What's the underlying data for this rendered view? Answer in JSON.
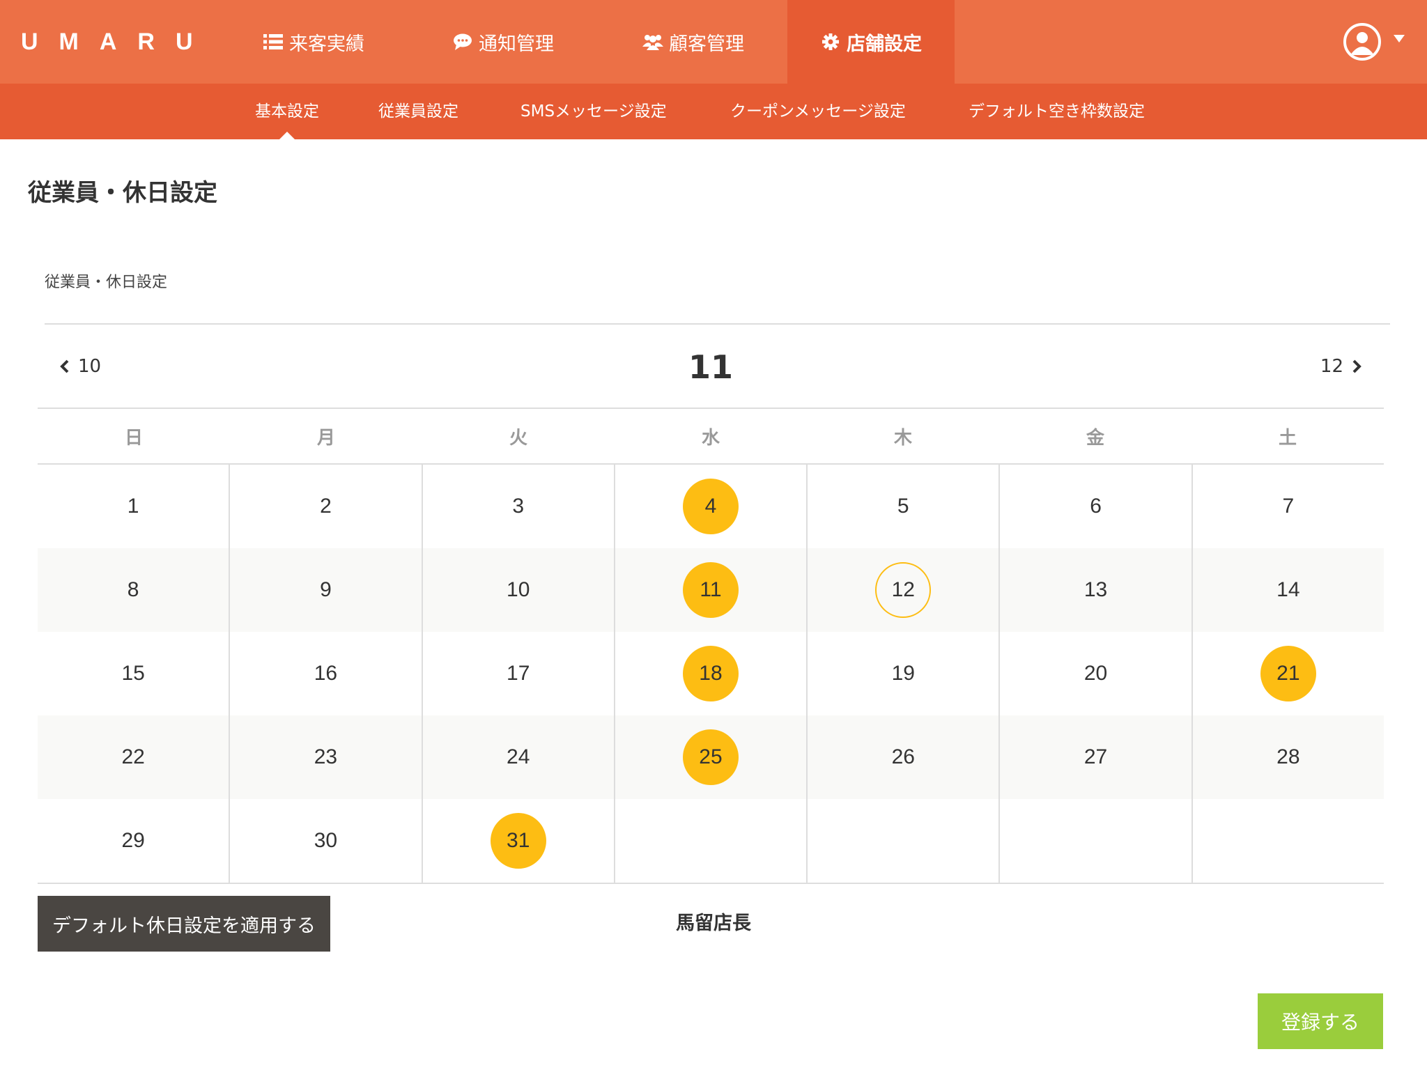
{
  "brand": {
    "logo": "UMARU"
  },
  "nav": {
    "items": [
      {
        "label": "来客実績",
        "icon": "list-icon"
      },
      {
        "label": "通知管理",
        "icon": "chat-bubble-icon"
      },
      {
        "label": "顧客管理",
        "icon": "users-icon"
      },
      {
        "label": "店舗設定",
        "icon": "gear-icon",
        "active": true
      }
    ],
    "user_icon": "user-circle-icon"
  },
  "subnav": {
    "items": [
      {
        "label": "基本設定",
        "active": true
      },
      {
        "label": "従業員設定"
      },
      {
        "label": "SMSメッセージ設定"
      },
      {
        "label": "クーポンメッセージ設定"
      },
      {
        "label": "デフォルト空き枠数設定"
      }
    ]
  },
  "page": {
    "title": "従業員・休日設定",
    "section_label": "従業員・休日設定"
  },
  "calendar": {
    "prev_month": "10",
    "current_month": "11",
    "next_month": "12",
    "weekdays": [
      "日",
      "月",
      "火",
      "水",
      "木",
      "金",
      "土"
    ],
    "weeks": [
      [
        "1",
        "2",
        "3",
        "4",
        "5",
        "6",
        "7"
      ],
      [
        "8",
        "9",
        "10",
        "11",
        "12",
        "13",
        "14"
      ],
      [
        "15",
        "16",
        "17",
        "18",
        "19",
        "20",
        "21"
      ],
      [
        "22",
        "23",
        "24",
        "25",
        "26",
        "27",
        "28"
      ],
      [
        "29",
        "30",
        "31",
        "",
        "",
        "",
        ""
      ]
    ],
    "holidays": [
      "4",
      "11",
      "18",
      "21",
      "25",
      "31"
    ],
    "today": "12",
    "holiday_color": "#fdbd13"
  },
  "actions": {
    "apply_default_label": "デフォルト休日設定を適用する",
    "staff_name": "馬留店長",
    "submit_label": "登録する"
  },
  "colors": {
    "nav_bg": "#ec7046",
    "subnav_bg": "#e65b33",
    "submit_bg": "#9acd3c",
    "dark_button_bg": "#4a4642"
  }
}
